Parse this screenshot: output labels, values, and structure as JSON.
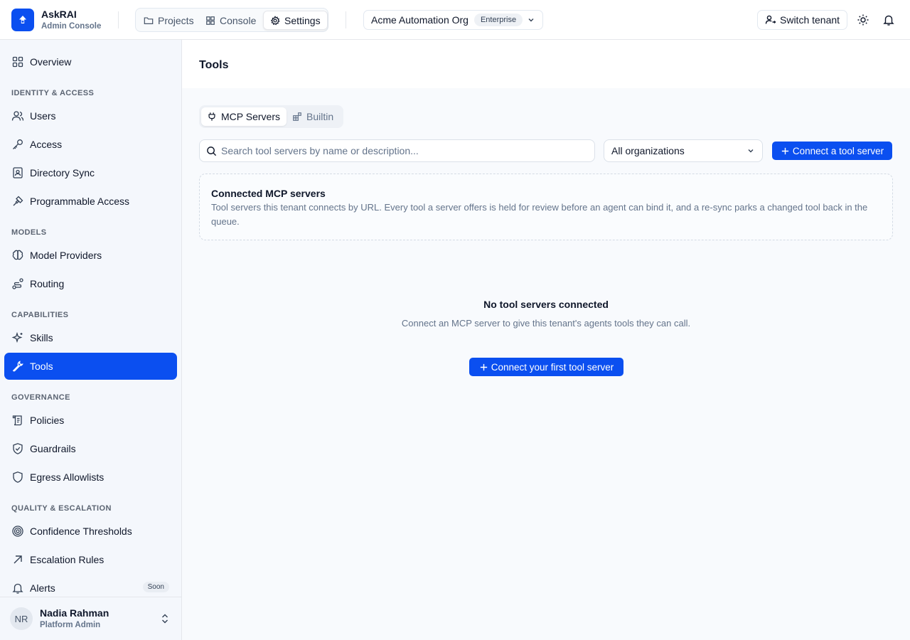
{
  "app": {
    "name": "AskRAI",
    "subtitle": "Admin Console"
  },
  "header": {
    "nav": [
      {
        "label": "Projects",
        "icon": "folder-icon"
      },
      {
        "label": "Console",
        "icon": "grid-icon"
      },
      {
        "label": "Settings",
        "icon": "gear-icon",
        "active": true
      }
    ],
    "org": {
      "name": "Acme Automation Org",
      "badge": "Enterprise"
    },
    "switch_tenant_label": "Switch tenant"
  },
  "sidebar": {
    "overview": "Overview",
    "sections": {
      "identity": "IDENTITY & ACCESS",
      "models": "MODELS",
      "capabilities": "CAPABILITIES",
      "governance": "GOVERNANCE",
      "quality": "QUALITY & ESCALATION"
    },
    "items": {
      "users": "Users",
      "access": "Access",
      "directory_sync": "Directory Sync",
      "programmable_access": "Programmable Access",
      "model_providers": "Model Providers",
      "routing": "Routing",
      "skills": "Skills",
      "tools": "Tools",
      "policies": "Policies",
      "guardrails": "Guardrails",
      "egress_allowlists": "Egress Allowlists",
      "confidence_thresholds": "Confidence Thresholds",
      "escalation_rules": "Escalation Rules",
      "alerts": "Alerts"
    },
    "alerts_badge": "Soon",
    "user": {
      "initials": "NR",
      "name": "Nadia Rahman",
      "role": "Platform Admin"
    }
  },
  "main": {
    "title": "Tools",
    "tabs": {
      "mcp": "MCP Servers",
      "builtin": "Builtin"
    },
    "search_placeholder": "Search tool servers by name or description...",
    "org_filter": "All organizations",
    "connect_button": "Connect a tool server",
    "card": {
      "title": "Connected MCP servers",
      "description": "Tool servers this tenant connects by URL. Every tool a server offers is held for review before an agent can bind it, and a re-sync parks a changed tool back in the queue."
    },
    "empty": {
      "title": "No tool servers connected",
      "description": "Connect an MCP server to give this tenant's agents tools they can call.",
      "button": "Connect your first tool server"
    }
  },
  "colors": {
    "accent": "#0b4ff0",
    "sidebar_bg": "#f4f7fc",
    "muted_text": "#64748b"
  }
}
